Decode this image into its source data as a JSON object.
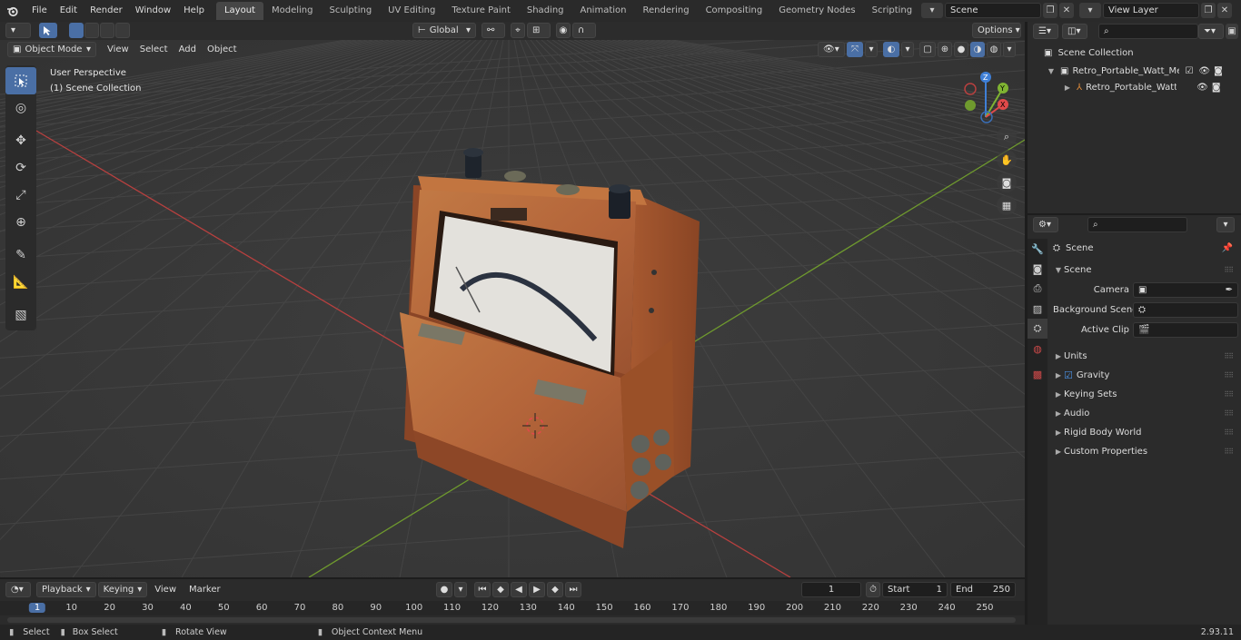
{
  "topbar": {
    "menus": [
      "File",
      "Edit",
      "Render",
      "Window",
      "Help"
    ],
    "workspaces": [
      "Layout",
      "Modeling",
      "Sculpting",
      "UV Editing",
      "Texture Paint",
      "Shading",
      "Animation",
      "Rendering",
      "Compositing",
      "Geometry Nodes",
      "Scripting"
    ],
    "active_workspace": "Layout",
    "scene_name": "Scene",
    "view_layer": "View Layer"
  },
  "viewport_header": {
    "mode": "Object Mode",
    "menus": [
      "View",
      "Select",
      "Add",
      "Object"
    ],
    "transform_orientation": "Global",
    "options_label": "Options"
  },
  "viewport": {
    "perspective_label": "User Perspective",
    "collection_label": "(1) Scene Collection",
    "gizmo_axes": [
      "Z",
      "Y",
      "X"
    ]
  },
  "outliner": {
    "root": "Scene Collection",
    "items": [
      {
        "label": "Retro_Portable_Watt_Meter_C"
      },
      {
        "label": "Retro_Portable_Watt_Me"
      }
    ]
  },
  "properties": {
    "context": "Scene",
    "section": "Scene",
    "fields": [
      {
        "label": "Camera"
      },
      {
        "label": "Background Scene"
      },
      {
        "label": "Active Clip"
      }
    ],
    "panels": [
      "Units",
      "Gravity",
      "Keying Sets",
      "Audio",
      "Rigid Body World",
      "Custom Properties"
    ],
    "gravity_checked": true
  },
  "timeline": {
    "menus": [
      "Playback",
      "Keying",
      "View",
      "Marker"
    ],
    "current_frame": "1",
    "start_label": "Start",
    "start": "1",
    "end_label": "End",
    "end": "250",
    "ruler": [
      "1",
      "10",
      "20",
      "30",
      "40",
      "50",
      "60",
      "70",
      "80",
      "90",
      "100",
      "110",
      "120",
      "130",
      "140",
      "150",
      "160",
      "170",
      "180",
      "190",
      "200",
      "210",
      "220",
      "230",
      "240",
      "250"
    ]
  },
  "statusbar": {
    "select": "Select",
    "box_select": "Box Select",
    "rotate_view": "Rotate View",
    "context_menu": "Object Context Menu",
    "version": "2.93.11"
  },
  "colors": {
    "accent": "#4a6fa5",
    "x_axis": "#e04a4a",
    "y_axis": "#7fb332",
    "z_axis": "#3f7fd6",
    "wood": "#b86a3a"
  }
}
